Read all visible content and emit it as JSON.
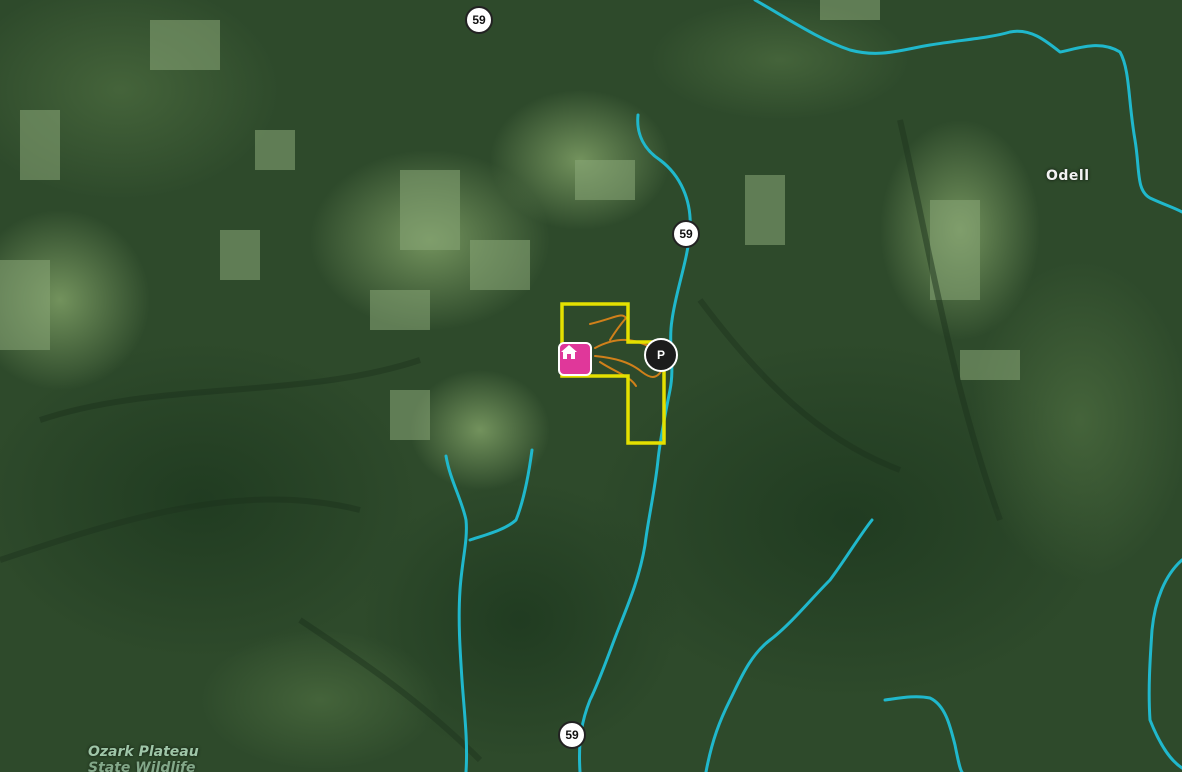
{
  "map": {
    "basemap": "satellite",
    "colors": {
      "stream": "#20b8cc",
      "boundary": "#e4e000",
      "trail": "#d0801a",
      "home_marker": "#e0379a",
      "parking_marker": "#1c1c1c"
    },
    "route_shields": [
      {
        "id": "top",
        "label": "59"
      },
      {
        "id": "mid",
        "label": "59"
      },
      {
        "id": "bottom",
        "label": "59"
      }
    ],
    "places": {
      "odell": "Odell",
      "ozark_line1": "Ozark Plateau",
      "ozark_line2": "State Wildlife"
    },
    "markers": {
      "home_icon": "home-icon",
      "parking_icon": "parking-icon",
      "parking_text": "P"
    }
  }
}
